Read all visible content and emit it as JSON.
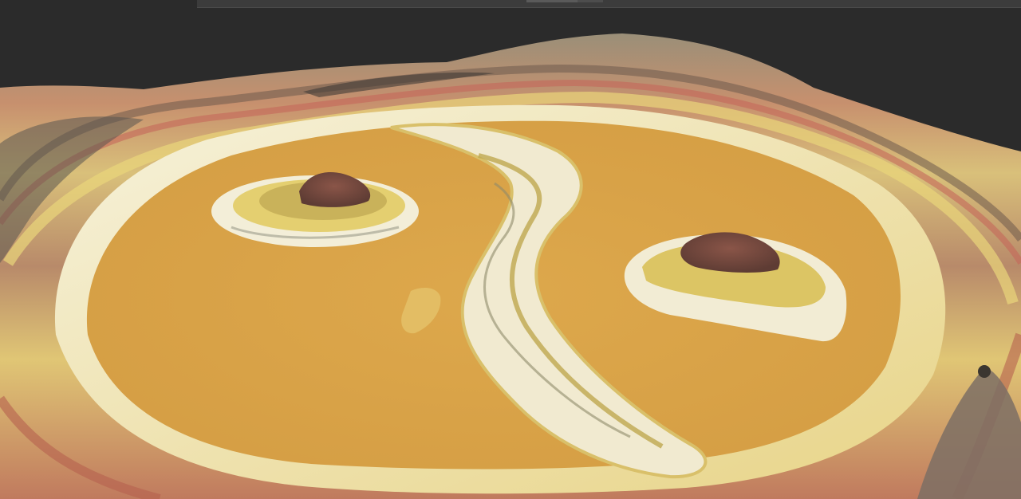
{
  "scene": {
    "background_color": "#2b2b2b",
    "toolbar_color": "#3c3c3c",
    "lake_color": "#dca54a",
    "rim_colors": [
      "#f3efd6",
      "#e6cf6e",
      "#b88a6a",
      "#c46a55",
      "#8a8f84"
    ],
    "peak_color": "#7a4a3e",
    "features": [
      "crater-terrain",
      "lake-left",
      "lake-right",
      "island-left",
      "island-right",
      "central-ridge",
      "crater-rim"
    ]
  }
}
